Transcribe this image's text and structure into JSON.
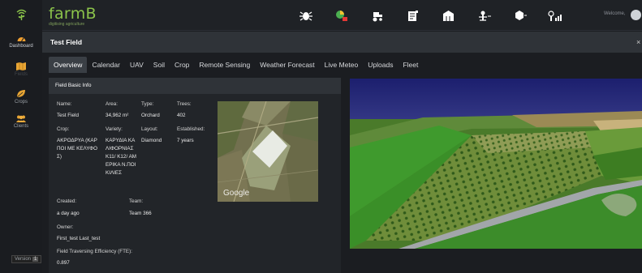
{
  "app": {
    "logo_text": "farmB",
    "logo_tagline": "digitising agriculture",
    "welcome_text": "Welcome,",
    "version_label": "Version",
    "version_number": "1"
  },
  "sidebar": {
    "items": [
      {
        "label": "Dashboard",
        "icon": "dashboard-icon"
      },
      {
        "label": "Fields",
        "icon": "map-icon"
      },
      {
        "label": "Crops",
        "icon": "leaf-icon"
      },
      {
        "label": "Clients",
        "icon": "clients-icon"
      }
    ]
  },
  "header": {
    "title": "Test Field",
    "close_symbol": "×"
  },
  "tabs": [
    {
      "label": "Overview",
      "active": true
    },
    {
      "label": "Calendar"
    },
    {
      "label": "UAV"
    },
    {
      "label": "Soil"
    },
    {
      "label": "Crop"
    },
    {
      "label": "Remote Sensing"
    },
    {
      "label": "Weather Forecast"
    },
    {
      "label": "Live Meteo"
    },
    {
      "label": "Uploads"
    },
    {
      "label": "Fleet"
    }
  ],
  "field_info": {
    "panel_title": "Field Basic Info",
    "name_label": "Name:",
    "name_value": "Test Field",
    "area_label": "Area:",
    "area_value": "34,962 m²",
    "type_label": "Type:",
    "type_value": "Orchard",
    "trees_label": "Trees:",
    "trees_value": "402",
    "crop_label": "Crop:",
    "crop_value": "ΑΚΡΟΔΡΥΑ (ΚΑΡΠΟΙ ΜΕ ΚΕΛΥΦΟΣ)",
    "variety_label": "Variety:",
    "variety_value": "ΚΑΡΥΔΙΑ ΚΑΛΙΦΟΡΝΙΑΣ Κ11/ Κ12/ ΑΜΕΡΙΚΑ Ν.ΠΟΙΚΙΛΙΕΣ",
    "layout_label": "Layout:",
    "layout_value": "Diamond",
    "established_label": "Established:",
    "established_value": "7 years",
    "created_label": "Created:",
    "created_value": "a day ago",
    "team_label": "Team:",
    "team_value": "Team 366",
    "owner_label": "Owner:",
    "owner_value": "First_test Last_test",
    "fte_label": "Field Traversing Efficiency (FTE):",
    "fte_value": "0.897",
    "map_watermark": "Google"
  },
  "top_icons": [
    "bug-icon",
    "crop-chart-icon",
    "tractor-icon",
    "document-icon",
    "storage-icon",
    "irrigation-icon",
    "drone-icon",
    "sensor-signal-icon"
  ],
  "colors": {
    "brand_green": "#8bc34a",
    "background": "#1b1d21",
    "panel": "#222529",
    "header_bar": "#2f3338"
  }
}
